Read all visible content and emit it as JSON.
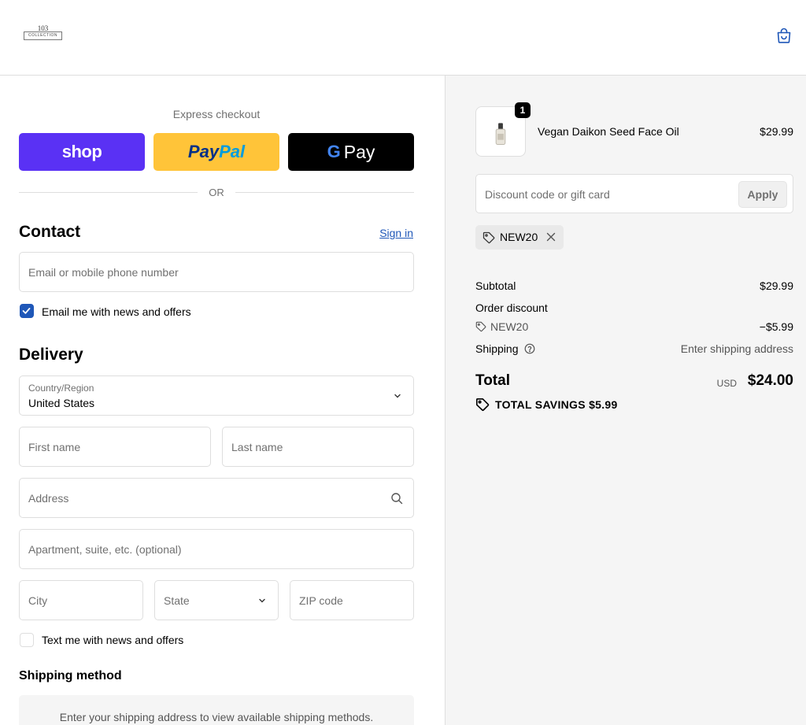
{
  "header": {
    "logo_number": "103",
    "logo_word": "COLLECTION",
    "cart_icon": "shopping-bag-icon"
  },
  "express": {
    "title": "Express checkout",
    "shop_label": "shop",
    "paypal_label_1": "Pay",
    "paypal_label_2": "Pal",
    "gpay_g": "G",
    "gpay_label": "Pay",
    "or_label": "OR"
  },
  "contact": {
    "title": "Contact",
    "sign_in": "Sign in",
    "email_placeholder": "Email or mobile phone number",
    "news_label": "Email me with news and offers",
    "news_checked": true
  },
  "delivery": {
    "title": "Delivery",
    "country_label": "Country/Region",
    "country_value": "United States",
    "first_name": "First name",
    "last_name": "Last name",
    "address": "Address",
    "apartment": "Apartment, suite, etc. (optional)",
    "city": "City",
    "state": "State",
    "zip": "ZIP code",
    "text_label": "Text me with news and offers",
    "text_checked": false
  },
  "shipping_method": {
    "title": "Shipping method",
    "message": "Enter your shipping address to view available shipping methods."
  },
  "summary": {
    "item": {
      "quantity": "1",
      "name": "Vegan Daikon Seed Face Oil",
      "price": "$29.99"
    },
    "discount_placeholder": "Discount code or gift card",
    "apply_label": "Apply",
    "applied_code": "NEW20",
    "subtotal_label": "Subtotal",
    "subtotal_value": "$29.99",
    "order_discount_label": "Order discount",
    "discount_code": "NEW20",
    "discount_value": "−$5.99",
    "shipping_label": "Shipping",
    "shipping_value": "Enter shipping address",
    "total_label": "Total",
    "currency": "USD",
    "total_value": "$24.00",
    "savings": "TOTAL SAVINGS  $5.99"
  },
  "colors": {
    "shop": "#5a31f4",
    "paypal": "#ffc439",
    "gpay": "#000000",
    "link": "#1f57b8",
    "summary_bg": "#f5f5f5"
  }
}
